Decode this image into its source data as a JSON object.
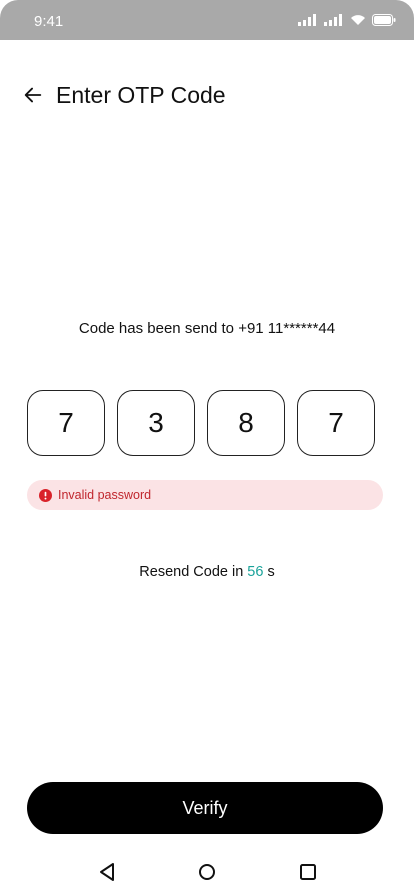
{
  "status_bar": {
    "time": "9:41"
  },
  "header": {
    "title": "Enter OTP Code"
  },
  "otp": {
    "sent_message": "Code has been send to +91 11******44",
    "digits": [
      "7",
      "3",
      "8",
      "7"
    ]
  },
  "error": {
    "message": "Invalid password"
  },
  "resend": {
    "prefix": "Resend Code in ",
    "seconds": "56",
    "suffix": " s"
  },
  "verify_button": {
    "label": "Verify"
  },
  "colors": {
    "status_bar": "#a9a9a9",
    "error_bg": "#fbe3e5",
    "error_text": "#c0262d",
    "countdown": "#1aa39a",
    "button": "#000000"
  },
  "icons": {
    "back": "arrow-left-icon",
    "error": "alert-circle-icon",
    "nav": [
      "nav-back-icon",
      "nav-home-icon",
      "nav-recents-icon"
    ]
  }
}
